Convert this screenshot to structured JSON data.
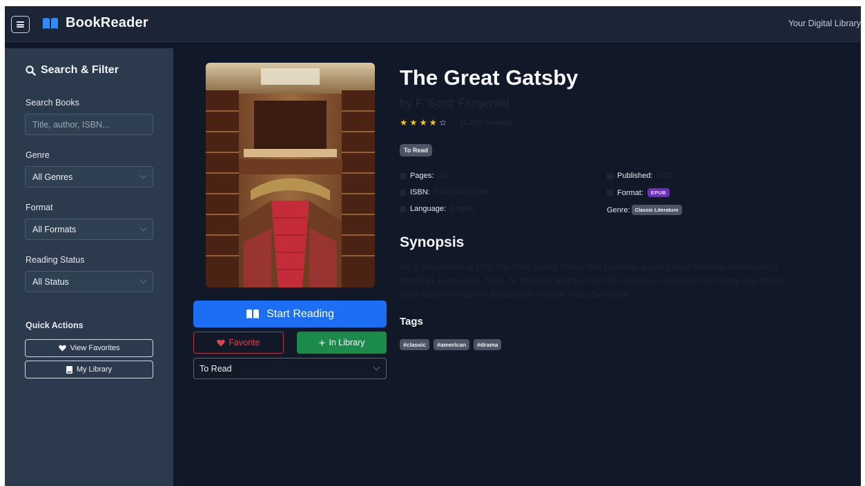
{
  "header": {
    "title": "BookReader",
    "tagline": "Your Digital Library",
    "accent": "#1c6ff5"
  },
  "sidebar": {
    "title": "Search & Filter",
    "search_label": "Search Books",
    "search_placeholder": "Title, author, ISBN...",
    "genre_label": "Genre",
    "genre_value": "All Genres",
    "format_label": "Format",
    "format_value": "All Formats",
    "status_label": "Reading Status",
    "status_value": "All Status",
    "quick_actions_label": "Quick Actions",
    "view_favorites": "View Favorites",
    "my_library": "My Library"
  },
  "book": {
    "title": "The Great Gatsby",
    "author": "by F. Scott Fitzgerald",
    "rating": 4,
    "rating_max": 5,
    "reviews": "(1,250 reviews)",
    "status": "To Read",
    "pages_label": "Pages:",
    "pages_value": "180",
    "published_label": "Published:",
    "published_value": "1925",
    "isbn_label": "ISBN:",
    "isbn_value": "9780743273565",
    "format_label": "Format:",
    "format_value": "EPUB",
    "language_label": "Language:",
    "language_value": "English",
    "genre_label": "Genre:",
    "genre_value": "Classic Literature",
    "synopsis_title": "Synopsis",
    "synopsis": "Set in the summer of 1922,The Great Gatsby follows Nick Carraway, a young bond salesman who moves to West Egg, Long Island. There, he becomes neighbors with the mysterious millionaire Jay Gatsby, who throws lavish parties in hopes of attracting his lost love, Daisy Buchanan.",
    "tags_title": "Tags",
    "tags": [
      "#classic",
      "#american",
      "#drama"
    ]
  },
  "actions": {
    "start_reading": "Start Reading",
    "favorite": "Favorite",
    "in_library": "In Library",
    "status_select": "To Read",
    "start_color": "#1c6ff5",
    "favorite_color": "#dc4652",
    "library_color": "#1c8a4a"
  }
}
